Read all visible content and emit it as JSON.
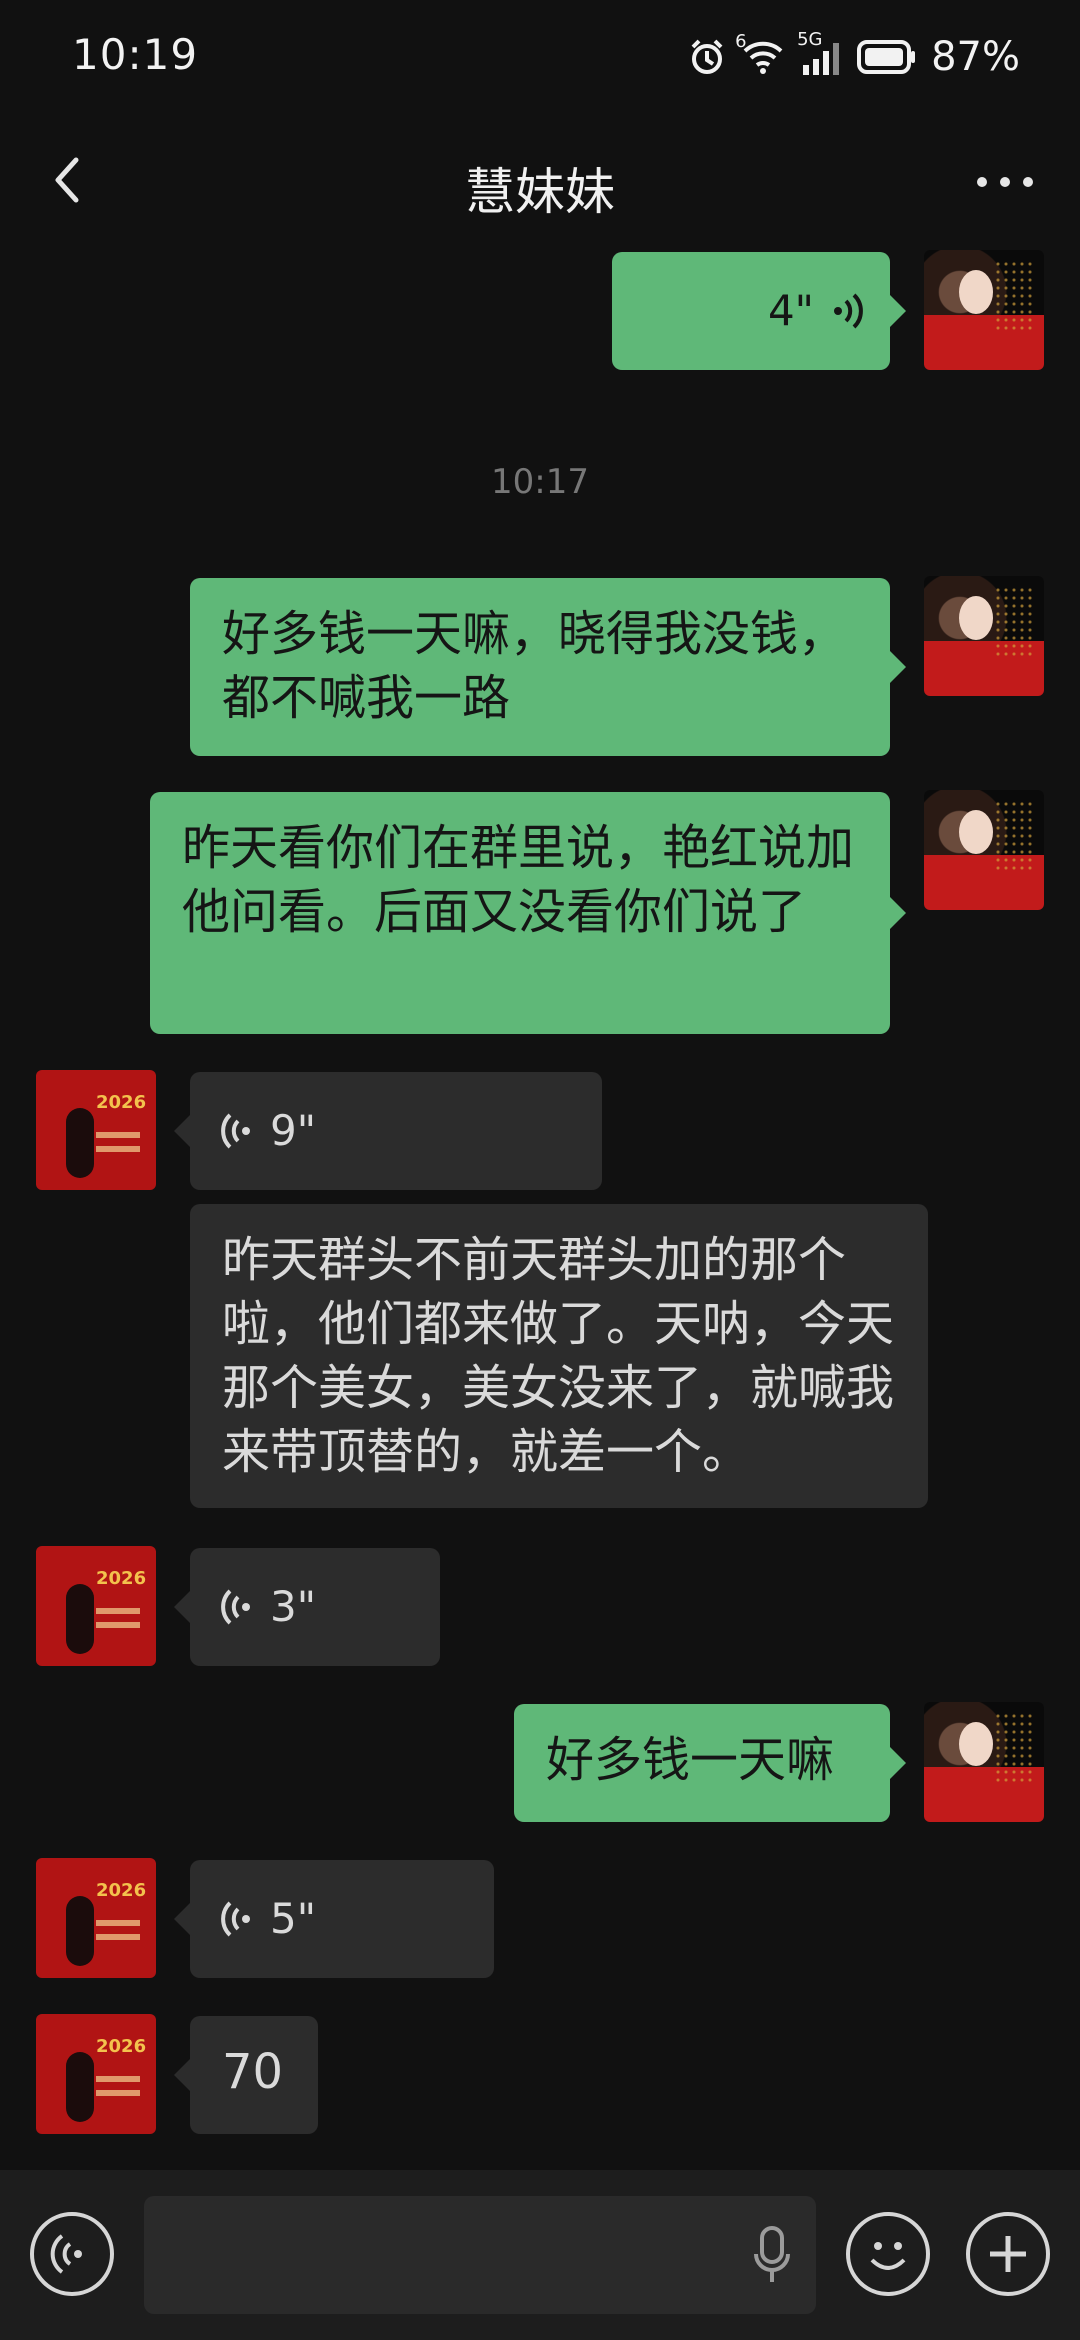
{
  "status_bar": {
    "time": "10:19",
    "network_label": "5G",
    "signal_small": "6",
    "battery_percent": "87%"
  },
  "header": {
    "title": "慧妹妹"
  },
  "messages": [
    {
      "type": "voice",
      "direction": "sent",
      "duration": "4\""
    },
    {
      "type": "time",
      "text": "10:17"
    },
    {
      "type": "text",
      "direction": "sent",
      "text": "好多钱一天嘛，晓得我没钱，都不喊我一路"
    },
    {
      "type": "text",
      "direction": "sent",
      "text": "昨天看你们在群里说，艳红说加他问看。后面又没看你们说了"
    },
    {
      "type": "voice",
      "direction": "received",
      "duration": "9\""
    },
    {
      "type": "text",
      "direction": "received",
      "text": "昨天群头不前天群头加的那个啦，他们都来做了。天呐，今天那个美女，美女没来了，就喊我来带顶替的，就差一个。"
    },
    {
      "type": "voice",
      "direction": "received",
      "duration": "3\""
    },
    {
      "type": "text",
      "direction": "sent",
      "text": "好多钱一天嘛"
    },
    {
      "type": "voice",
      "direction": "received",
      "duration": "5\""
    },
    {
      "type": "text",
      "direction": "received",
      "text": "70"
    }
  ],
  "avatar_her": {
    "badge_text": "2026"
  },
  "colors": {
    "background": "#111111",
    "sent_bubble": "#5fb878",
    "received_bubble": "#2c2c2c"
  },
  "icons": {
    "back": "chevron-left-icon",
    "more": "more-dots-icon",
    "voice_toggle": "voice-icon",
    "mic": "mic-icon",
    "emoji": "emoji-icon",
    "plus": "plus-icon"
  }
}
